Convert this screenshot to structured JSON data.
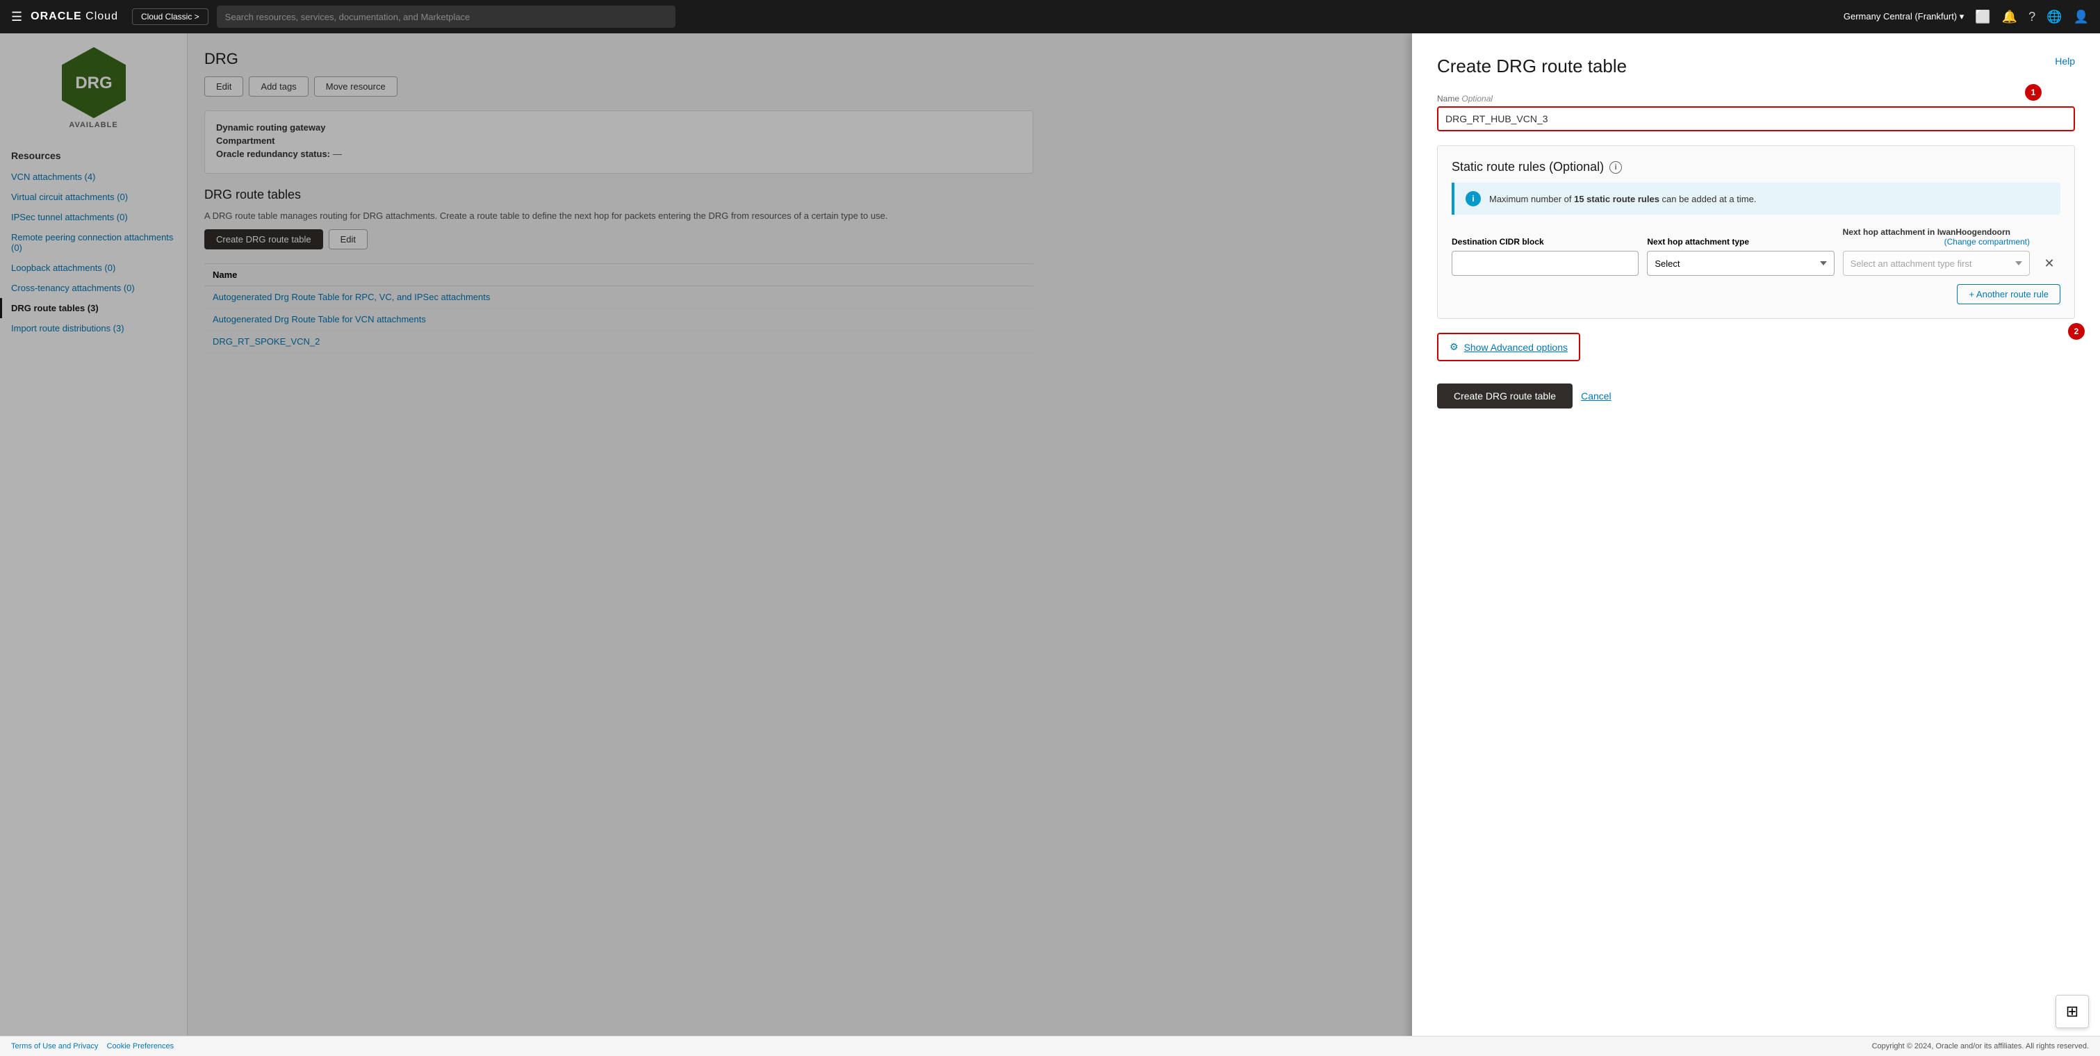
{
  "topnav": {
    "hamburger_icon": "☰",
    "logo_text": "ORACLE",
    "logo_cloud": "Cloud",
    "cloud_classic_label": "Cloud Classic >",
    "search_placeholder": "Search resources, services, documentation, and Marketplace",
    "region": "Germany Central (Frankfurt)",
    "region_icon": "▾",
    "terminal_icon": "⬜",
    "bell_icon": "🔔",
    "help_icon": "?",
    "globe_icon": "🌐",
    "user_icon": "👤"
  },
  "sidebar": {
    "drg_label": "DRG",
    "available_label": "AVAILABLE",
    "resources_title": "Resources",
    "nav_items": [
      {
        "id": "vcn-attachments",
        "label": "VCN attachments (4)",
        "active": false
      },
      {
        "id": "virtual-circuit-attachments",
        "label": "Virtual circuit attachments (0)",
        "active": false
      },
      {
        "id": "ipsec-tunnel-attachments",
        "label": "IPSec tunnel attachments (0)",
        "active": false
      },
      {
        "id": "remote-peering-connection",
        "label": "Remote peering connection attachments (0)",
        "active": false
      },
      {
        "id": "loopback-attachments",
        "label": "Loopback attachments (0)",
        "active": false
      },
      {
        "id": "cross-tenancy-attachments",
        "label": "Cross-tenancy attachments (0)",
        "active": false
      },
      {
        "id": "drg-route-tables",
        "label": "DRG route tables (3)",
        "active": true
      },
      {
        "id": "import-route-distributions",
        "label": "Import route distributions (3)",
        "active": false
      }
    ]
  },
  "content": {
    "page_title": "DRG",
    "action_buttons": [
      "Edit",
      "Add tags",
      "Move resource"
    ],
    "gateway_label": "Dynamic routing gateway",
    "compartment_label": "Compartment",
    "redundancy_label": "Oracle redundancy status:",
    "redundancy_value": "—",
    "tables_title": "DRG route tables",
    "tables_desc": "A DRG route table manages routing for DRG attachments. Create a route table to define the next hop for packets entering the DRG from resources of a certain type to use.",
    "create_btn": "Create DRG route table",
    "edit_btn": "Edit",
    "name_column": "Name",
    "table_rows": [
      {
        "id": "autogenerated-rpc",
        "label": "Autogenerated Drg Route Table for RPC, VC, and IPSec attachments"
      },
      {
        "id": "autogenerated-vcn",
        "label": "Autogenerated Drg Route Table for VCN attachments"
      },
      {
        "id": "drg-rt-spoke-vcn2",
        "label": "DRG_RT_SPOKE_VCN_2"
      }
    ]
  },
  "panel": {
    "title": "Create DRG route table",
    "help_link": "Help",
    "step1_badge": "1",
    "step2_badge": "2",
    "name_label": "Name",
    "name_optional": "Optional",
    "name_value": "DRG_RT_HUB_VCN_3",
    "name_placeholder": "",
    "static_rules_title": "Static route rules (Optional)",
    "info_banner_text": "Maximum number of",
    "info_banner_bold": "15 static route rules",
    "info_banner_suffix": "can be added at a time.",
    "dest_cidr_label": "Destination CIDR block",
    "next_hop_type_label": "Next hop attachment type",
    "next_hop_select_placeholder": "Select",
    "next_hop_attachment_label": "Next hop attachment in",
    "compartment_name": "IwanHoogendoorn",
    "change_compartment_link": "(Change compartment)",
    "attachment_placeholder": "Select an attachment type first",
    "add_rule_label": "+ Another route rule",
    "show_advanced_label": "Show Advanced options",
    "create_btn": "Create DRG route table",
    "cancel_btn": "Cancel"
  },
  "footer": {
    "terms_link": "Terms of Use and Privacy",
    "cookie_link": "Cookie Preferences",
    "copyright": "Copyright © 2024, Oracle and/or its affiliates. All rights reserved."
  }
}
